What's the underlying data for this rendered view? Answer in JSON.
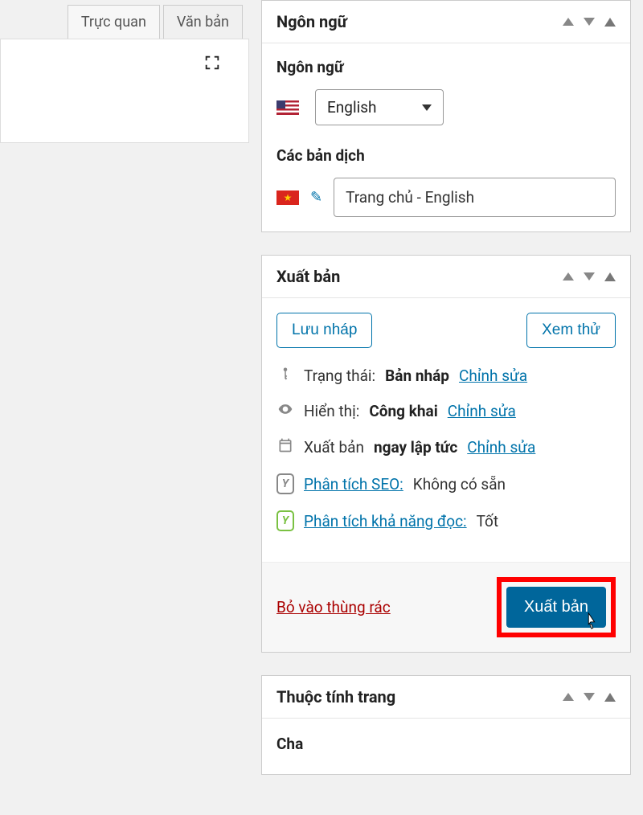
{
  "editor": {
    "tabs": {
      "visual": "Trực quan",
      "text": "Văn bản"
    }
  },
  "language_box": {
    "title": "Ngôn ngữ",
    "field_label": "Ngôn ngữ",
    "selected": "English",
    "translations_label": "Các bản dịch",
    "translation_value": "Trang chủ - English"
  },
  "publish_box": {
    "title": "Xuất bản",
    "save_draft": "Lưu nháp",
    "preview": "Xem thử",
    "status_label": "Trạng thái:",
    "status_value": "Bản nháp",
    "edit": "Chỉnh sửa",
    "visibility_label": "Hiển thị:",
    "visibility_value": "Công khai",
    "publish_label": "Xuất bản",
    "publish_value": "ngay lập tức",
    "seo_label": "Phân tích SEO:",
    "seo_value": "Không có sẵn",
    "readability_label": "Phân tích khả năng đọc:",
    "readability_value": "Tốt",
    "trash": "Bỏ vào thùng rác",
    "publish_button": "Xuất bản"
  },
  "attributes_box": {
    "title": "Thuộc tính trang",
    "parent_label": "Cha"
  }
}
